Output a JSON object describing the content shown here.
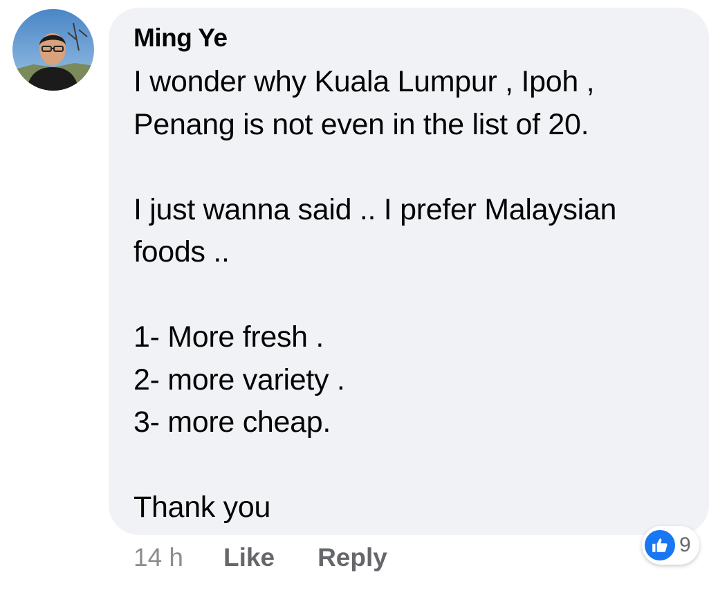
{
  "comment": {
    "author": "Ming Ye",
    "lines": [
      "I wonder why Kuala Lumpur , Ipoh ,",
      "Penang is not even in the list of 20.",
      "",
      "I just wanna said .. I prefer Malaysian",
      "foods ..",
      "",
      "1- More fresh .",
      "2- more variety .",
      "3- more cheap.",
      "",
      "Thank you"
    ],
    "avatar_icon": "profile-photo",
    "colors": {
      "bubble": "#f0f2f5",
      "like_blue": "#1877f2",
      "secondary_text": "#65676b"
    }
  },
  "actions": {
    "time": "14 h",
    "like_label": "Like",
    "reply_label": "Reply"
  },
  "reactions": {
    "icon": "like-thumb-icon",
    "count": "9"
  }
}
